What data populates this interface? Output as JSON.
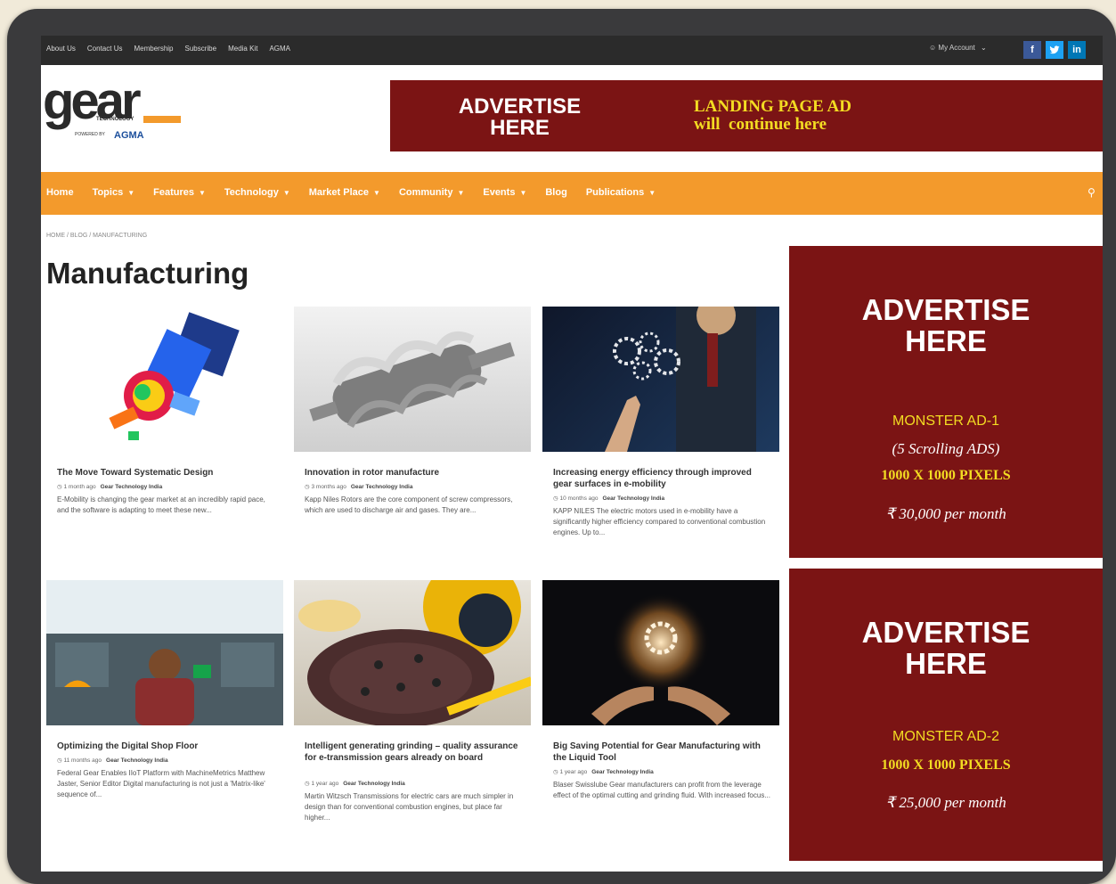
{
  "topbar": {
    "links": [
      "About Us",
      "Contact Us",
      "Membership",
      "Subscribe",
      "Media Kit",
      "AGMA"
    ],
    "account_label": "My Account",
    "social": [
      "f",
      "t",
      "in"
    ]
  },
  "logo": {
    "word": "gear",
    "technology": "TECHNOLOGY",
    "powered_by": "POWERED BY",
    "agma": "AGMA"
  },
  "top_ad": {
    "main": "ADVERTISE\nHERE",
    "side": "LANDING PAGE AD\nwill  continue here"
  },
  "nav": {
    "items": [
      {
        "label": "Home",
        "dropdown": false
      },
      {
        "label": "Topics",
        "dropdown": true
      },
      {
        "label": "Features",
        "dropdown": true
      },
      {
        "label": "Technology",
        "dropdown": true
      },
      {
        "label": "Market Place",
        "dropdown": true
      },
      {
        "label": "Community",
        "dropdown": true
      },
      {
        "label": "Events",
        "dropdown": true
      },
      {
        "label": "Blog",
        "dropdown": false
      },
      {
        "label": "Publications",
        "dropdown": true
      }
    ]
  },
  "breadcrumb": "HOME / BLOG / MANUFACTURING",
  "page_title": "Manufacturing",
  "articles": [
    {
      "title": "The Move Toward Systematic Design",
      "time": "1 month ago",
      "author": "Gear Technology India",
      "excerpt": "E-Mobility is changing the gear market at an incredibly rapid pace, and the software is adapting to meet these new..."
    },
    {
      "title": "Innovation in rotor manufacture",
      "time": "3 months ago",
      "author": "Gear Technology India",
      "excerpt": "Kapp Niles Rotors are the core component of screw compressors, which are used to discharge air and gases. They are..."
    },
    {
      "title": "Increasing energy efficiency through improved gear surfaces in e-mobility",
      "time": "10 months ago",
      "author": "Gear Technology India",
      "excerpt": "KAPP NILES The electric motors used in e-mobility have a significantly higher efficiency compared to conventional combustion engines. Up to..."
    },
    {
      "title": "Optimizing the Digital Shop Floor",
      "time": "11 months ago",
      "author": "Gear Technology India",
      "excerpt": "Federal Gear Enables IIoT Platform with MachineMetrics Matthew Jaster, Senior Editor Digital manufacturing is not just a 'Matrix-like' sequence of..."
    },
    {
      "title": "Intelligent generating grinding – quality assurance for e-transmission gears already on board",
      "time": "1 year ago",
      "author": "Gear Technology India",
      "excerpt": "Martin Witzsch Transmissions for electric cars are much simpler in design than for conventional combustion engines, but place far higher..."
    },
    {
      "title": "Big Saving Potential for Gear Manufacturing with the Liquid Tool",
      "time": "1 year ago",
      "author": "Gear Technology India",
      "excerpt": "Blaser Swisslube Gear manufacturers can profit from the leverage effect of the optimal cutting and grinding fluid. With increased focus..."
    }
  ],
  "side_ads": [
    {
      "main": "ADVERTISE\nHERE",
      "name": "MONSTER AD-1",
      "note": "(5 Scrolling ADS)",
      "size": "1000 X 1000 PIXELS",
      "price": "₹ 30,000 per month"
    },
    {
      "main": "ADVERTISE\nHERE",
      "name": "MONSTER AD-2",
      "size": "1000 X 1000 PIXELS",
      "price": "₹ 25,000 per month"
    }
  ],
  "colors": {
    "brand_orange": "#f39a2c",
    "ad_maroon": "#7b1414",
    "ad_yellow": "#f3dc22",
    "topbar": "#2b2b2b"
  }
}
